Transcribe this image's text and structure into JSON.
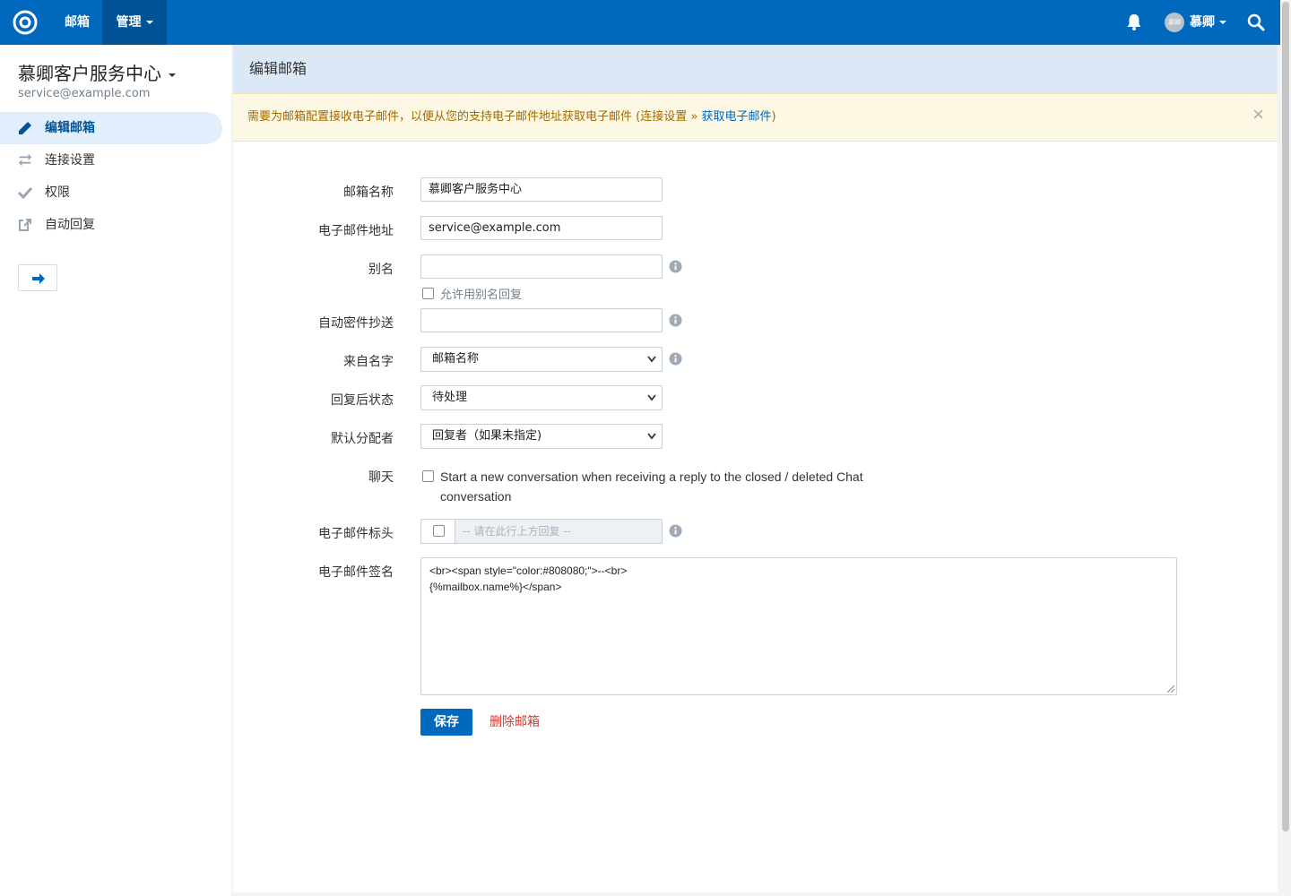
{
  "topbar": {
    "nav": [
      "邮箱",
      "管理"
    ],
    "avatar_text": "慕卿",
    "user_name": "慕卿"
  },
  "sidebar": {
    "mailbox_name": "慕卿客户服务中心",
    "mailbox_email": "service@example.com",
    "items": [
      {
        "label": "编辑邮箱",
        "icon": "pencil-icon",
        "active": true
      },
      {
        "label": "连接设置",
        "icon": "exchange-icon",
        "active": false
      },
      {
        "label": "权限",
        "icon": "check-icon",
        "active": false
      },
      {
        "label": "自动回复",
        "icon": "share-icon",
        "active": false
      }
    ]
  },
  "page": {
    "title": "编辑邮箱",
    "alert": {
      "text": "需要为邮箱配置接收电子邮件，以便从您的支持电子邮件地址获取电子邮件 (连接设置 » ",
      "link": "获取电子邮件",
      "suffix": ")",
      "close": "×"
    }
  },
  "form": {
    "mailbox_name": {
      "label": "邮箱名称",
      "value": "慕卿客户服务中心"
    },
    "email": {
      "label": "电子邮件地址",
      "value": "service@example.com"
    },
    "aliases": {
      "label": "别名",
      "value": "",
      "checkbox_label": "允许用别名回复"
    },
    "auto_bcc": {
      "label": "自动密件抄送",
      "value": ""
    },
    "from_name": {
      "label": "来自名字",
      "value": "邮箱名称"
    },
    "status_after_reply": {
      "label": "回复后状态",
      "value": "待处理"
    },
    "default_assignee": {
      "label": "默认分配者",
      "value": "回复者（如果未指定)"
    },
    "chat": {
      "label": "聊天",
      "checkbox_label": "Start a new conversation when receiving a reply to the closed / deleted Chat conversation"
    },
    "email_header": {
      "label": "电子邮件标头",
      "placeholder": "-- 请在此行上方回复 --"
    },
    "signature": {
      "label": "电子邮件签名",
      "value": "<br><span style=\"color:#808080;\">--<br>\n{%mailbox.name%}</span>"
    },
    "save_label": "保存",
    "delete_label": "删除邮箱"
  },
  "colors": {
    "brand": "#0068bd",
    "alert_bg": "#fcf8e3",
    "danger": "#d9342b"
  }
}
